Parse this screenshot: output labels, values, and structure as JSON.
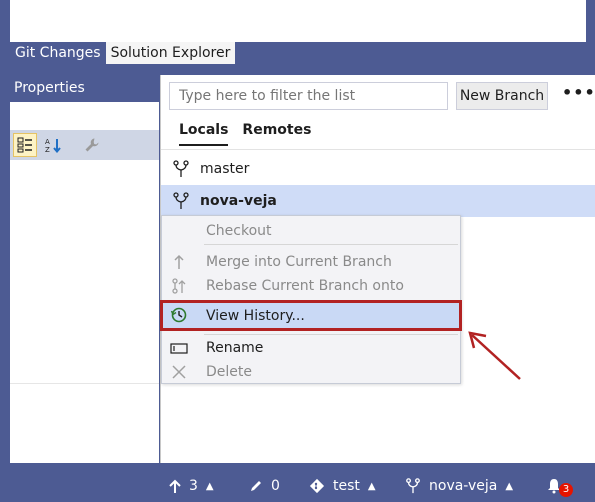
{
  "tool_tabs": [
    {
      "label": "Git Changes"
    },
    {
      "label": "Solution Explorer"
    }
  ],
  "properties": {
    "title": "Properties"
  },
  "git_panel": {
    "filter_placeholder": "Type here to filter the list",
    "filter_value": "",
    "new_branch_label": "New Branch",
    "more_label": "•••",
    "tabs": [
      {
        "label": "Locals"
      },
      {
        "label": "Remotes"
      }
    ],
    "branches": [
      {
        "name": "master",
        "selected": false
      },
      {
        "name": "nova-veja",
        "selected": true
      }
    ]
  },
  "context_menu": {
    "items": [
      {
        "label": "Checkout",
        "enabled": false
      },
      {
        "label": "Merge into Current Branch",
        "enabled": false
      },
      {
        "label": "Rebase Current Branch onto",
        "enabled": false
      },
      {
        "label": "View History...",
        "enabled": true,
        "highlighted": true
      },
      {
        "label": "Rename",
        "enabled": true
      },
      {
        "label": "Delete",
        "enabled": false
      }
    ]
  },
  "status_bar": {
    "outgoing_count": "3",
    "pending_changes": "0",
    "repository": "test",
    "branch": "nova-veja",
    "notification_count": "3"
  },
  "colors": {
    "accent": "#4d5b93",
    "selection": "#cfdcf7",
    "highlight_box": "#b22222",
    "badge": "#e51400"
  }
}
